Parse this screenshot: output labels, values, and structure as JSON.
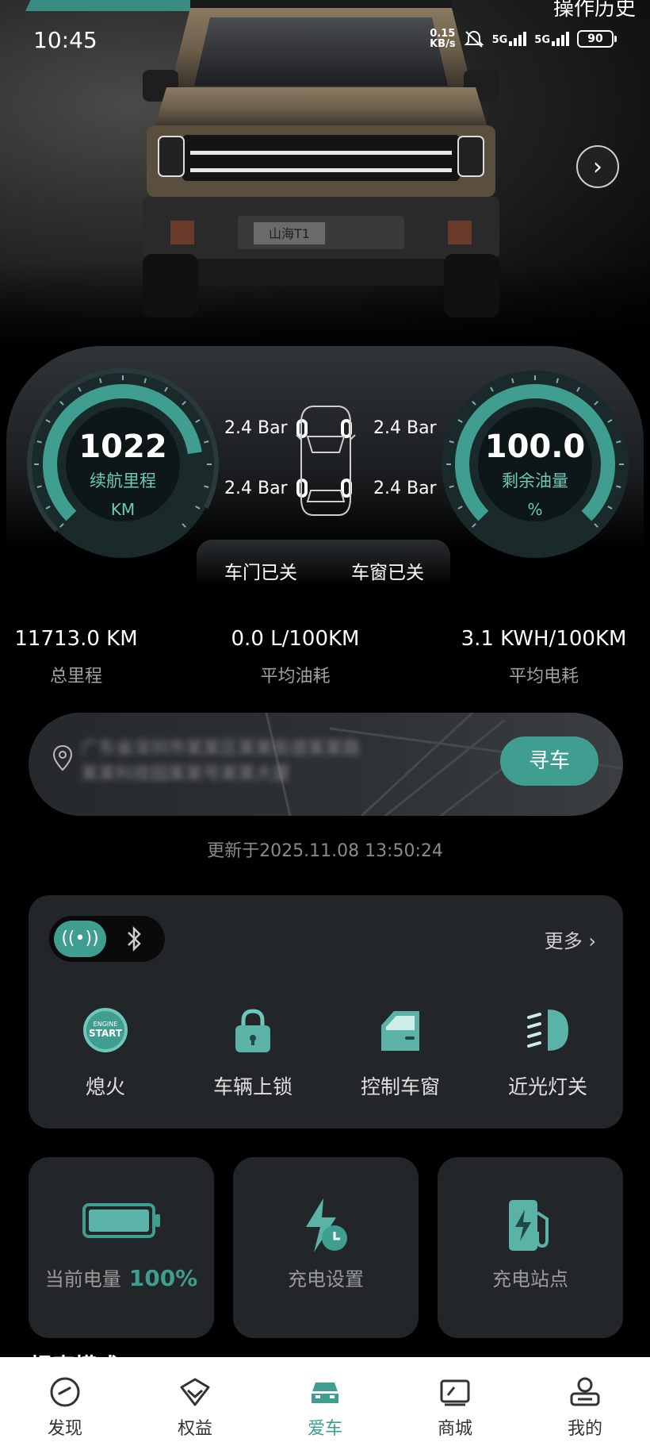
{
  "status_bar": {
    "time": "10:45",
    "net_speed_value": "0.15",
    "net_speed_unit": "KB/s",
    "sim1": "5G",
    "sim2": "5G",
    "battery": "90"
  },
  "header": {
    "history_label": "操作历史"
  },
  "gauges": {
    "range": {
      "value": "1022",
      "label": "续航里程",
      "unit": "KM",
      "fill_fraction": 0.8
    },
    "fuel": {
      "value": "100.0",
      "label": "剩余油量",
      "unit": "%",
      "fill_fraction": 1.0
    }
  },
  "tires": {
    "front_left": "2.4 Bar",
    "front_right": "2.4 Bar",
    "rear_left": "2.4 Bar",
    "rear_right": "2.4 Bar"
  },
  "doors": {
    "door_status": "车门已关",
    "window_status": "车窗已关"
  },
  "stats": [
    {
      "value": "11713.0 KM",
      "label": "总里程"
    },
    {
      "value": "0.0 L/100KM",
      "label": "平均油耗"
    },
    {
      "value": "3.1 KWH/100KM",
      "label": "平均电耗"
    }
  ],
  "location": {
    "address_line1": "广东省深圳市某某区某某街道某某路",
    "address_line2": "某某科技园某某号某某大厦",
    "find_car_label": "寻车",
    "updated": "更新于2025.11.08 13:50:24"
  },
  "controls": {
    "more_label": "更多",
    "items": [
      {
        "label": "熄火",
        "icon": "engine-start-icon"
      },
      {
        "label": "车辆上锁",
        "icon": "lock-icon"
      },
      {
        "label": "控制车窗",
        "icon": "car-window-icon"
      },
      {
        "label": "近光灯关",
        "icon": "low-beam-icon"
      }
    ]
  },
  "charge": {
    "battery_label": "当前电量",
    "battery_value": "100%",
    "battery_fraction": 1.0,
    "settings_label": "充电设置",
    "stations_label": "充电站点"
  },
  "section_peek": "坦克模式",
  "nav": [
    {
      "label": "发现",
      "icon": "discover-icon",
      "active": false
    },
    {
      "label": "权益",
      "icon": "benefits-icon",
      "active": false
    },
    {
      "label": "爱车",
      "icon": "car-icon",
      "active": true
    },
    {
      "label": "商城",
      "icon": "mall-icon",
      "active": false
    },
    {
      "label": "我的",
      "icon": "profile-icon",
      "active": false
    }
  ],
  "colors": {
    "accent": "#3f9e8f",
    "gauge_text": "#6fc7bb",
    "card_bg": "#222629"
  }
}
